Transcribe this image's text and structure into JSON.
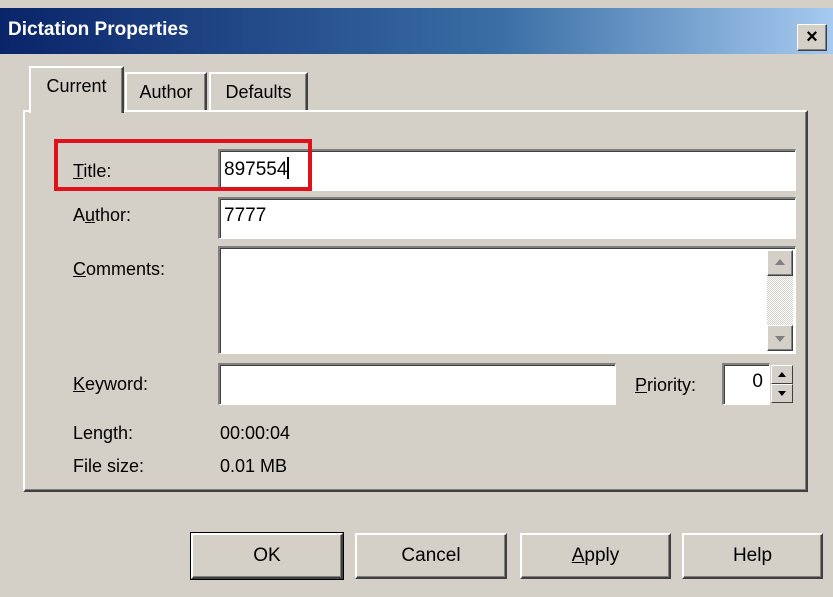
{
  "window": {
    "title": "Dictation Properties",
    "close_glyph": "×"
  },
  "tabs": [
    {
      "label": "Current",
      "active": true
    },
    {
      "label": "Author",
      "active": false
    },
    {
      "label": "Defaults",
      "active": false
    }
  ],
  "form": {
    "title": {
      "label_mnemonic": "T",
      "label_rest": "itle:",
      "value": "897554"
    },
    "author": {
      "label_pre": "A",
      "label_mnemonic": "u",
      "label_rest": "thor:",
      "value": "7777"
    },
    "comments": {
      "label_mnemonic": "C",
      "label_rest": "omments:",
      "value": ""
    },
    "keyword": {
      "label_mnemonic": "K",
      "label_rest": "eyword:",
      "value": ""
    },
    "priority": {
      "label_mnemonic": "P",
      "label_rest": "riority:",
      "value": "0"
    },
    "length": {
      "label": "Length:",
      "value": "00:00:04"
    },
    "file_size": {
      "label": "File size:",
      "value": "0.01 MB"
    }
  },
  "buttons": {
    "ok": "OK",
    "cancel": "Cancel",
    "apply_mnemonic": "A",
    "apply_rest": "pply",
    "help": "Help"
  },
  "highlight_color": "#e0111b"
}
